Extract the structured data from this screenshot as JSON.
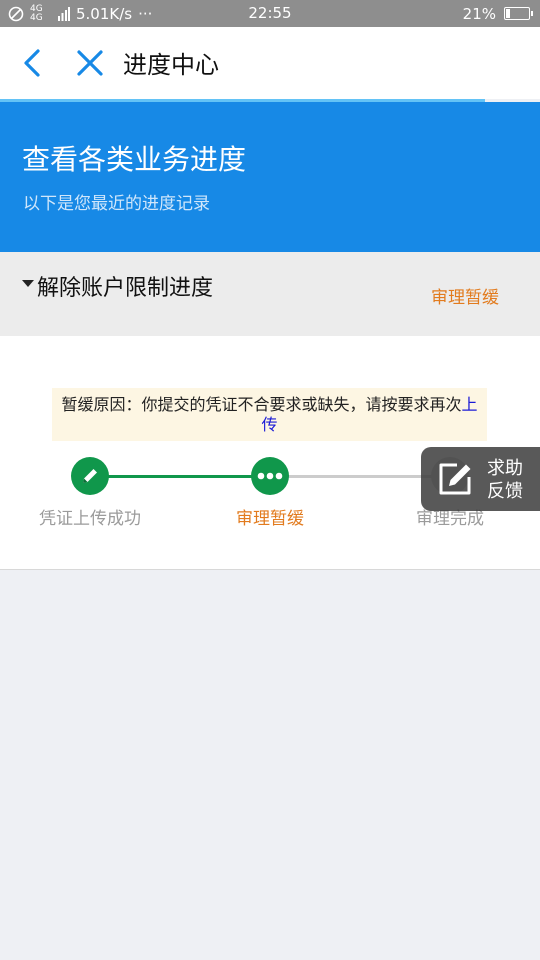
{
  "status_bar": {
    "network": "4G 4G",
    "speed": "5.01K/s",
    "more": "···",
    "time": "22:55",
    "battery_percent": "21%",
    "battery_level": 0.21
  },
  "header": {
    "title": "进度中心"
  },
  "banner": {
    "title": "查看各类业务进度",
    "subtitle": "以下是您最近的进度记录"
  },
  "section": {
    "title": "解除账户限制进度",
    "status": "审理暂缓"
  },
  "reason": {
    "text": "暂缓原因：你提交的凭证不合要求或缺失，请按要求再次",
    "link": "上传"
  },
  "steps": [
    {
      "label": "凭证上传成功",
      "state": "done"
    },
    {
      "label": "审理暂缓",
      "state": "current"
    },
    {
      "label": "审理完成",
      "state": "pending"
    }
  ],
  "help_button": {
    "line1": "求助",
    "line2": "反馈"
  },
  "colors": {
    "brand_blue": "#1789e6",
    "success_green": "#10974b",
    "warning_orange": "#e27b1e"
  },
  "icons": [
    "back-arrow-icon",
    "close-icon",
    "pencil-icon",
    "more-dots-icon",
    "feedback-edit-icon"
  ]
}
